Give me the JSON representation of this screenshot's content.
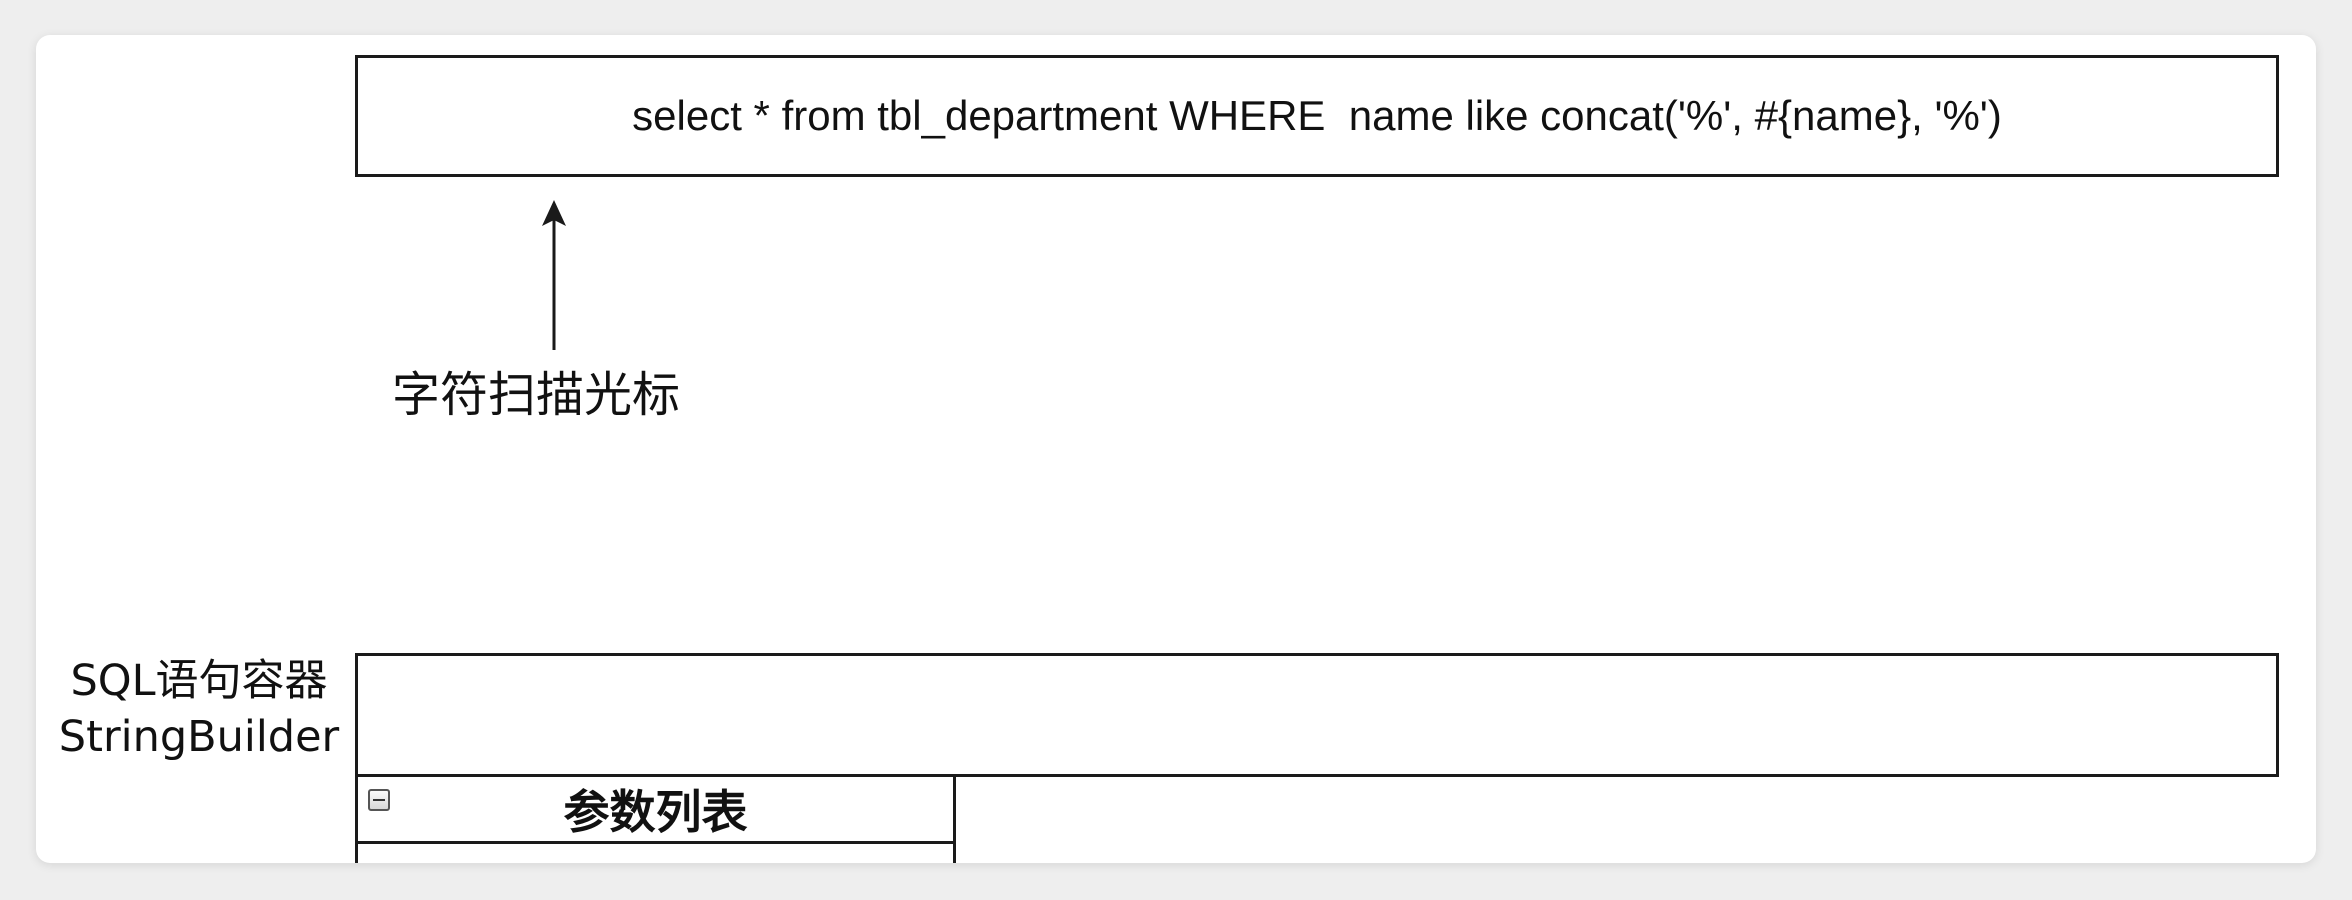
{
  "sql_box": {
    "text": "select * from tbl_department WHERE  name like concat('%', #{name}, '%')"
  },
  "cursor_label": "字符扫描光标",
  "container_label": {
    "line1": "SQL语句容器",
    "line2": "StringBuilder"
  },
  "param_table": {
    "title": "参数列表",
    "collapse_icon": "minus-box-icon"
  },
  "colors": {
    "line": "#1a1a1a",
    "text": "#111111",
    "background": "#ffffff",
    "page": "#eeeeee"
  }
}
